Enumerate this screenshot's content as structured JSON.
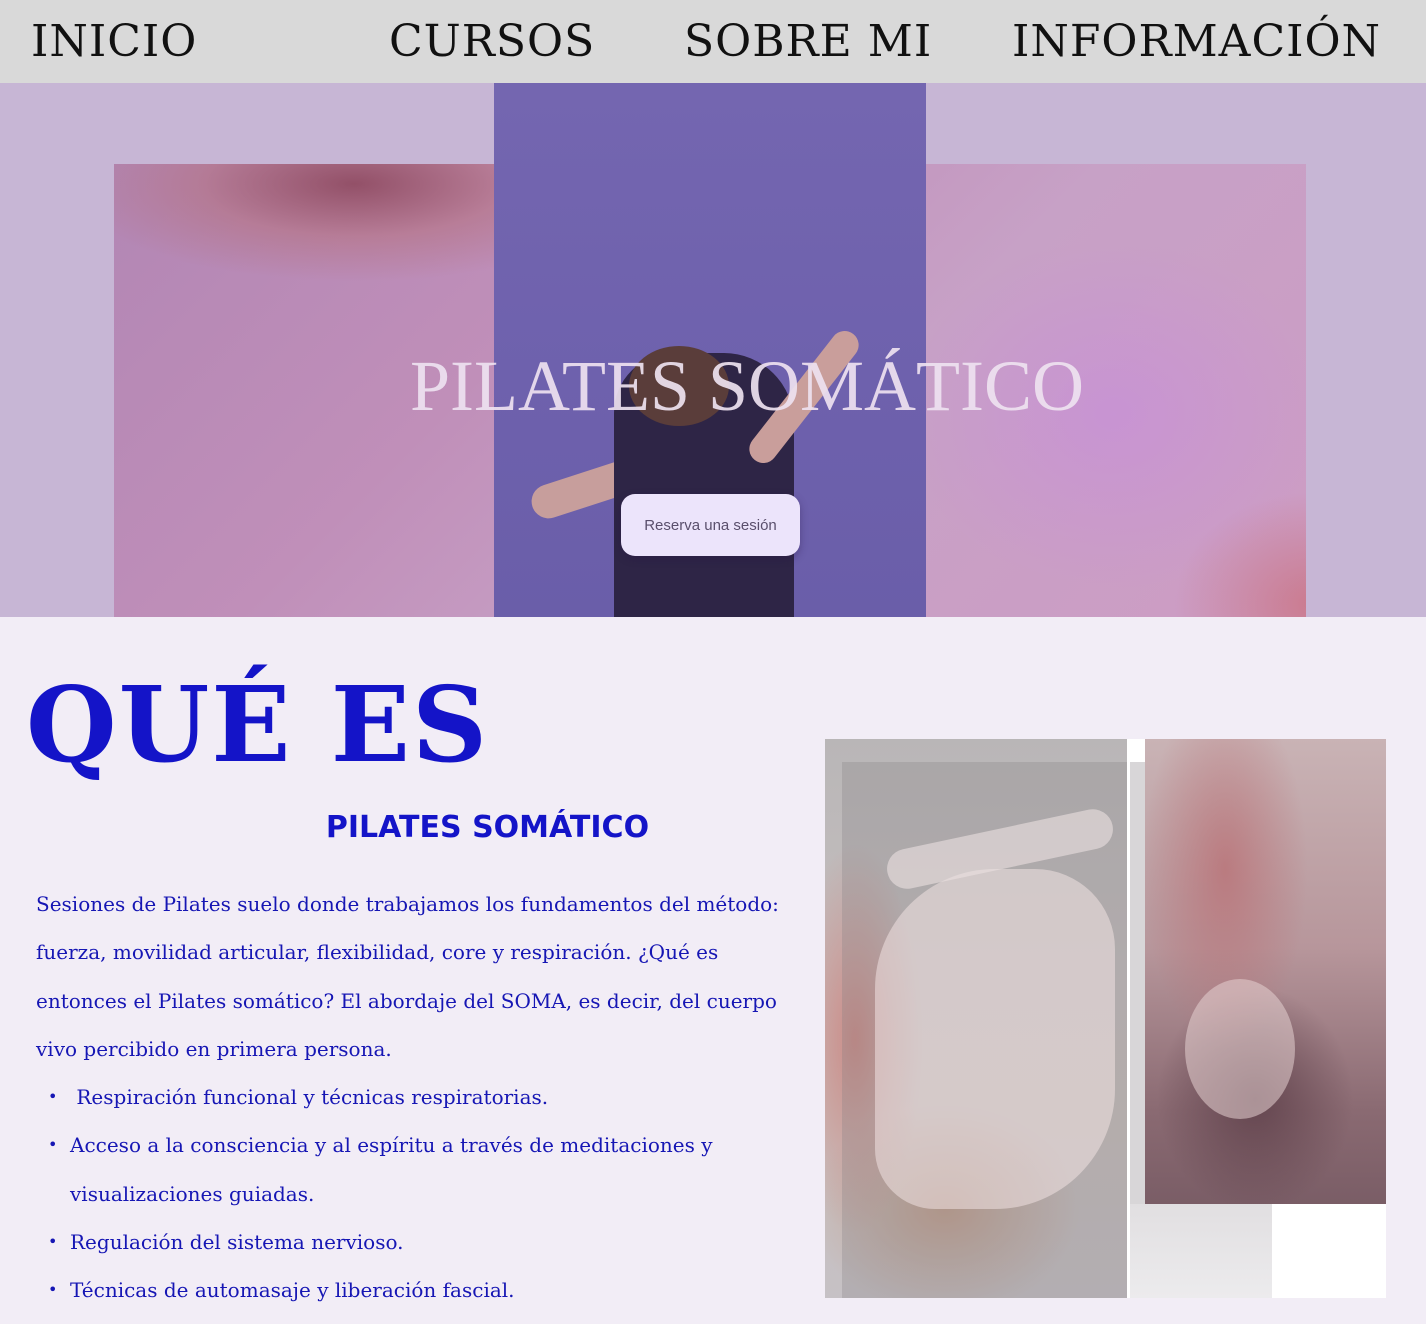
{
  "nav": {
    "items": [
      {
        "label": "INICIO"
      },
      {
        "label": "CURSOS"
      },
      {
        "label": "SOBRE MI"
      },
      {
        "label": "INFORMACIÓN"
      }
    ]
  },
  "hero": {
    "title": "PILATES SOMÁTICO",
    "cta_label": "Reserva una sesión"
  },
  "about": {
    "heading": "QUÉ ES",
    "subheading": "PILATES SOMÁTICO",
    "description": "Sesiones de Pilates suelo donde trabajamos los fundamentos del método: fuerza, movilidad articular, flexibilidad, core y respiración. ¿Qué es entonces el Pilates somático? El abordaje del SOMA, es decir, del cuerpo vivo percibido en primera persona.",
    "features": [
      " Respiración funcional y técnicas respiratorias.",
      "Acceso a la consciencia y al espíritu a través de meditaciones y visualizaciones guiadas.",
      "Regulación del sistema nervioso.",
      "Técnicas de automasaje y liberación fascial."
    ],
    "bullet": "•"
  },
  "colors": {
    "nav_bg": "#d9d9d9",
    "hero_bg": "#c7b6d5",
    "hero_panel": "#6e61ad",
    "page_bg": "#f2edf6",
    "accent_text": "#1414c8",
    "cta_bg": "#ece4fb"
  }
}
